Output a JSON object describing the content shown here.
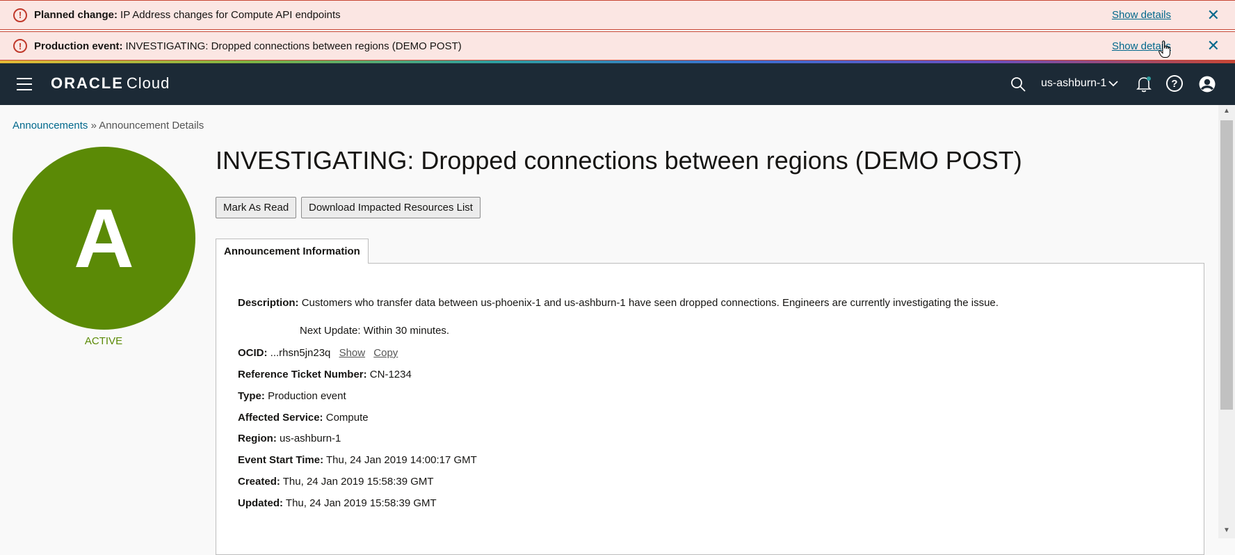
{
  "banners": [
    {
      "label": "Planned change:",
      "text": "IP Address changes for Compute API endpoints",
      "link": "Show details",
      "close": "✕"
    },
    {
      "label": "Production event:",
      "text": "INVESTIGATING: Dropped connections between regions (DEMO POST)",
      "link": "Show details",
      "close": "✕"
    }
  ],
  "topbar": {
    "logo_brand": "ORACLE",
    "logo_product": "Cloud",
    "region": "us-ashburn-1",
    "icons": [
      "menu-icon",
      "search-icon",
      "chevron-down-icon",
      "bell-icon",
      "help-icon",
      "user-icon"
    ]
  },
  "breadcrumb": {
    "root": "Announcements",
    "separator": "»",
    "current": "Announcement Details"
  },
  "avatar": {
    "letter": "A",
    "status": "ACTIVE",
    "color": "#5b8a06"
  },
  "title": "INVESTIGATING: Dropped connections between regions (DEMO POST)",
  "buttons": {
    "mark_read": "Mark As Read",
    "download": "Download Impacted Resources List"
  },
  "tab": "Announcement Information",
  "details": {
    "description_label": "Description:",
    "description": "Customers who transfer data between us-phoenix-1 and us-ashburn-1 have seen dropped connections. Engineers are currently investigating the issue.",
    "next_update": "Next Update: Within 30 minutes.",
    "ocid_label": "OCID:",
    "ocid": "...rhsn5jn23q",
    "ocid_show": "Show",
    "ocid_copy": "Copy",
    "ticket_label": "Reference Ticket Number:",
    "ticket": "CN-1234",
    "type_label": "Type:",
    "type": "Production event",
    "service_label": "Affected Service:",
    "service": "Compute",
    "region_label": "Region:",
    "region": "us-ashburn-1",
    "start_label": "Event Start Time:",
    "start": "Thu, 24 Jan 2019 14:00:17 GMT",
    "created_label": "Created:",
    "created": "Thu, 24 Jan 2019 15:58:39 GMT",
    "updated_label": "Updated:",
    "updated": "Thu, 24 Jan 2019 15:58:39 GMT"
  },
  "colors": {
    "banner_bg": "#fbe6e3",
    "banner_border": "#c74634",
    "topbar": "#1c2a36",
    "link": "#00688c",
    "active": "#5b8a06"
  }
}
